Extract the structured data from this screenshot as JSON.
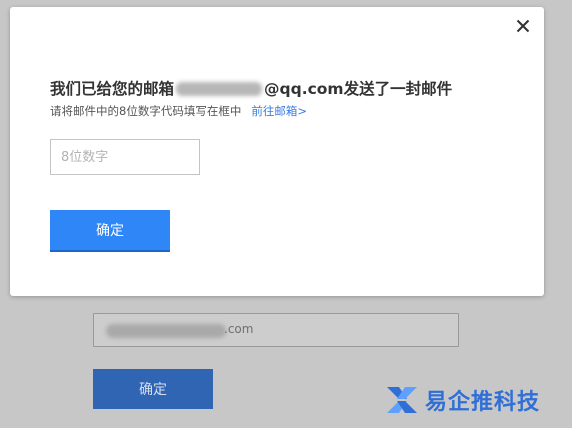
{
  "dialog": {
    "title_prefix": "我们已给您的邮箱",
    "title_suffix": "@qq.com发送了一封邮件",
    "subtitle": "请将邮件中的8位数字代码填写在框中",
    "mail_link": "前往邮箱>",
    "code_placeholder": "8位数字",
    "confirm_label": "确定"
  },
  "background": {
    "email_suffix": ".com",
    "confirm_label": "确定"
  },
  "watermark": {
    "text": "易企推科技"
  },
  "colors": {
    "primary": "#2f86f6",
    "link": "#3b7be0",
    "overlay_button": "#2f65b2",
    "watermark": "#2f6fd7"
  }
}
